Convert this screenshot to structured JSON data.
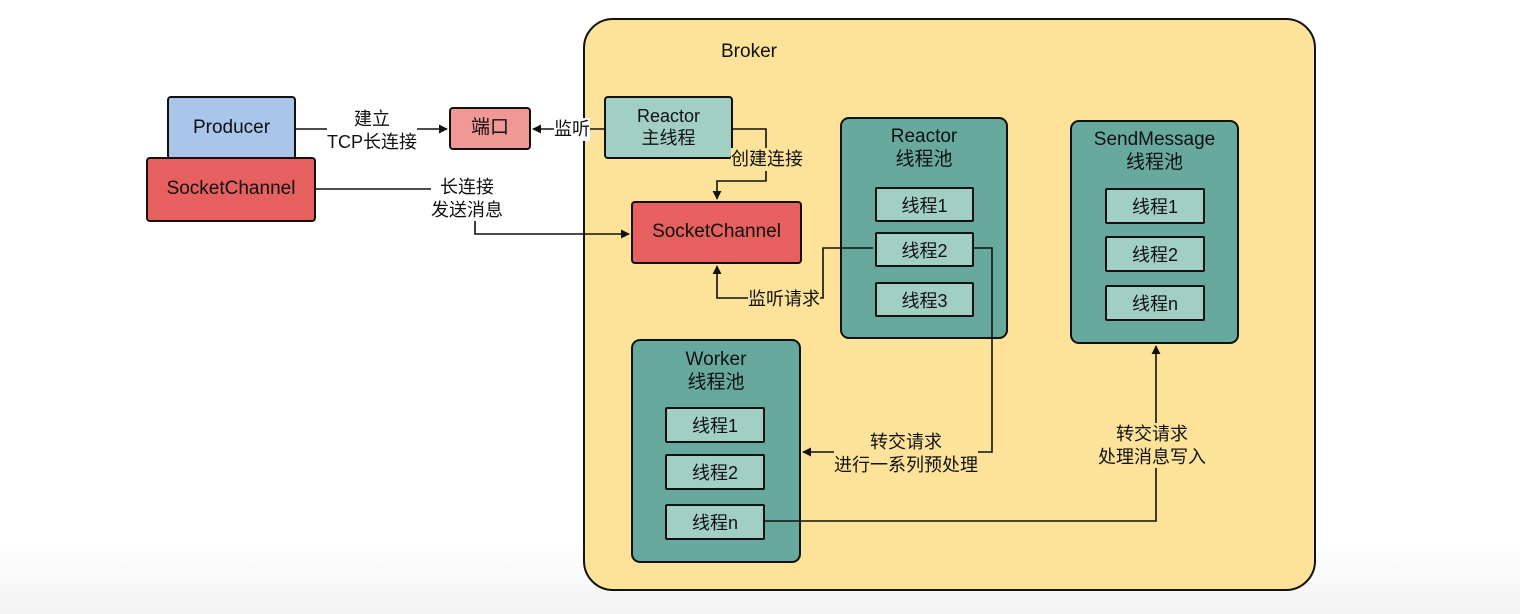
{
  "broker": {
    "title": "Broker"
  },
  "producer": {
    "name": "Producer",
    "channel": "SocketChannel"
  },
  "port": {
    "label": "端口"
  },
  "reactor_main": {
    "line1": "Reactor",
    "line2": "主线程"
  },
  "broker_channel": {
    "label": "SocketChannel"
  },
  "reactor_pool": {
    "line1": "Reactor",
    "line2": "线程池",
    "threads": [
      "线程1",
      "线程2",
      "线程3"
    ]
  },
  "sendmessage_pool": {
    "line1": "SendMessage",
    "line2": "线程池",
    "threads": [
      "线程1",
      "线程2",
      "线程n"
    ]
  },
  "worker_pool": {
    "line1": "Worker",
    "line2": "线程池",
    "threads": [
      "线程1",
      "线程2",
      "线程n"
    ]
  },
  "edges": {
    "connect_line1": "建立",
    "connect_line2": "TCP长连接",
    "listen": "监听",
    "create_connection": "创建连接",
    "send_line1": "长连接",
    "send_line2": "发送消息",
    "listen_request": "监听请求",
    "to_worker_line1": "转交请求",
    "to_worker_line2": "进行一系列预处理",
    "to_send_line1": "转交请求",
    "to_send_line2": "处理消息写入"
  },
  "colors": {
    "broker_fill": "#fde29a",
    "pool_fill": "#67a99d",
    "thread_fill": "#a2cfc4",
    "channel_fill": "#e5605f",
    "producer_fill": "#a9c5ea",
    "port_fill": "#ef9895"
  }
}
